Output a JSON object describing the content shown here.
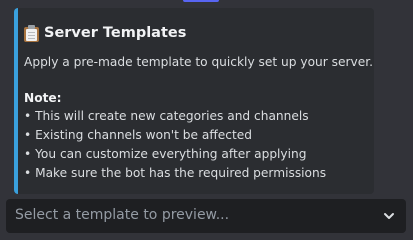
{
  "embed": {
    "title_icon": "clipboard-icon",
    "title": "Server Templates",
    "description": "Apply a pre-made template to quickly set up your server.",
    "note_label": "Note:",
    "notes": [
      "• This will create new categories and channels",
      "• Existing channels won't be affected",
      "• You can customize everything after applying",
      "• Make sure the bot has the required permissions"
    ],
    "accent_color": "#3aa0dd"
  },
  "select": {
    "placeholder": "Select a template to preview...",
    "icon": "chevron-down-icon"
  },
  "colors": {
    "background": "#323339",
    "embed_background": "#2b2d31",
    "select_background": "#1e1f22"
  }
}
